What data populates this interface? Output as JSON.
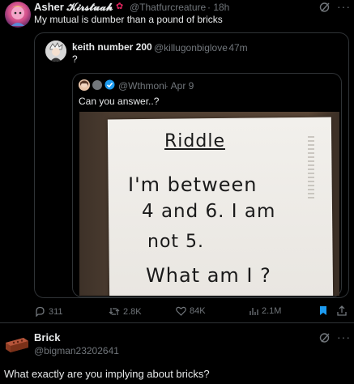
{
  "tweet1": {
    "display_name": "Asher 𝓚𝓲𝓻𝓼𝓽𝓾𝓪𝓱",
    "handle": "@Thatfurcreature",
    "time": "· 18h",
    "text": "My mutual is dumber than a pound of bricks",
    "actions": {
      "replies": "311",
      "retweets": "2.8K",
      "likes": "84K",
      "views": "2.1M"
    }
  },
  "quote1": {
    "display_name": "keith number 200",
    "handle": "@killugonbiglove",
    "time": "· 47m",
    "text": "?"
  },
  "quote2": {
    "handle": "@Wthmoni",
    "time": "· Apr 9",
    "text": "Can you answer..?"
  },
  "photo": {
    "lines": [
      "Riddle",
      "I'm between",
      "4 and 6. I am",
      "not 5.",
      "What am I ?"
    ]
  },
  "reply": {
    "display_name": "Brick",
    "handle": "@bigman23202641",
    "text": "What exactly are you implying about bricks?"
  },
  "colors": {
    "accent": "#1d9bf0",
    "muted": "#71767b",
    "border": "#2f3336"
  }
}
